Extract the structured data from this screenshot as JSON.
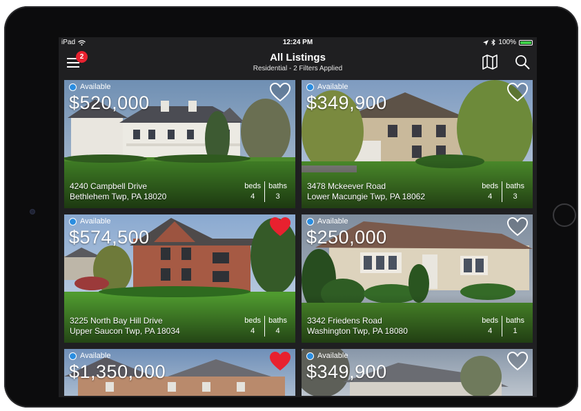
{
  "status_bar": {
    "device": "iPad",
    "time": "12:24 PM",
    "battery": "100%",
    "battery_level": 1.0
  },
  "header": {
    "title": "All Listings",
    "subtitle": "Residential - 2 Filters Applied",
    "notification_count": "2",
    "icons": {
      "menu": "hamburger-menu-icon",
      "map": "map-icon",
      "search": "search-icon"
    }
  },
  "colors": {
    "favorite": "#e8212f",
    "available_dot": "#2a8de0",
    "battery": "#3fd14a"
  },
  "listings": [
    {
      "status": "Available",
      "price": "$520,000",
      "address1": "4240 Campbell Drive",
      "address2": "Bethlehem Twp, PA 18020",
      "beds_label": "beds",
      "beds": "4",
      "baths_label": "baths",
      "baths": "3",
      "favorited": false
    },
    {
      "status": "Available",
      "price": "$349,900",
      "address1": "3478 Mckeever Road",
      "address2": "Lower Macungie Twp, PA 18062",
      "beds_label": "beds",
      "beds": "4",
      "baths_label": "baths",
      "baths": "3",
      "favorited": false
    },
    {
      "status": "Available",
      "price": "$574,500",
      "address1": "3225 North Bay Hill Drive",
      "address2": "Upper Saucon Twp, PA 18034",
      "beds_label": "beds",
      "beds": "4",
      "baths_label": "baths",
      "baths": "4",
      "favorited": true
    },
    {
      "status": "Available",
      "price": "$250,000",
      "address1": "3342 Friedens Road",
      "address2": "Washington Twp, PA 18080",
      "beds_label": "beds",
      "beds": "4",
      "baths_label": "baths",
      "baths": "1",
      "favorited": false
    },
    {
      "status": "Available",
      "price": "$1,350,000",
      "favorited": true
    },
    {
      "status": "Available",
      "price": "$349,900",
      "favorited": false
    }
  ]
}
